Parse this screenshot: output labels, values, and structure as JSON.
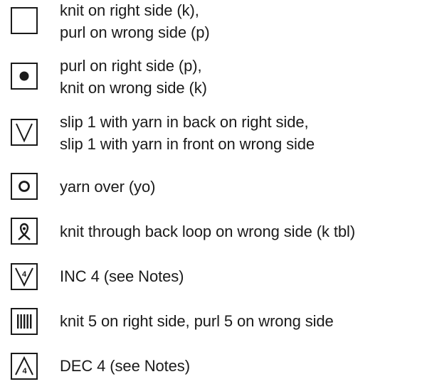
{
  "legend": {
    "entries": [
      {
        "icon": "empty-square-icon",
        "lines": [
          "knit on right side (k),",
          "purl on wrong side (p)"
        ]
      },
      {
        "icon": "dot-icon",
        "lines": [
          "purl on right side (p),",
          "knit on wrong side (k)"
        ]
      },
      {
        "icon": "v-slip-icon",
        "lines": [
          "slip 1 with yarn in back on right side,",
          "slip 1 with yarn in front on wrong side"
        ]
      },
      {
        "icon": "yarn-over-circle-icon",
        "lines": [
          "yarn over (yo)"
        ]
      },
      {
        "icon": "twisted-loop-icon",
        "lines": [
          "knit through back loop on wrong side (k tbl)"
        ]
      },
      {
        "icon": "inc-4-icon",
        "symbol_text": "4",
        "lines": [
          "INC 4 (see Notes)"
        ]
      },
      {
        "icon": "five-bars-icon",
        "lines": [
          "knit 5 on right side, purl 5 on wrong side"
        ]
      },
      {
        "icon": "dec-4-icon",
        "symbol_text": "4",
        "lines": [
          "DEC 4 (see Notes)"
        ]
      }
    ]
  }
}
